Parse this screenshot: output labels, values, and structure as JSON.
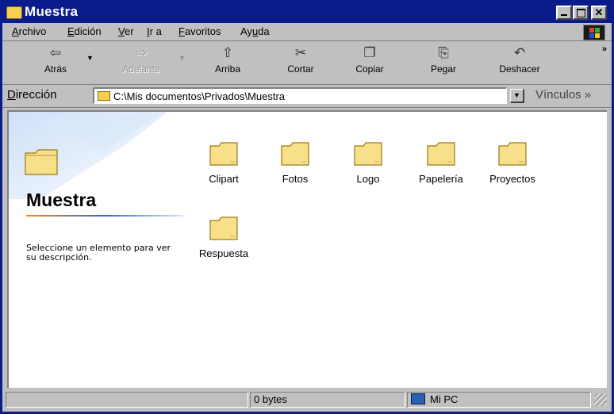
{
  "window": {
    "title": "Muestra",
    "controls": [
      "minimize-icon",
      "maximize-icon",
      "close-icon"
    ]
  },
  "menu": {
    "items": [
      {
        "label": "Archivo",
        "hotkey": "A"
      },
      {
        "label": "Edición",
        "hotkey": "E"
      },
      {
        "label": "Ver",
        "hotkey": "V"
      },
      {
        "label": "Ir a",
        "hotkey": "I"
      },
      {
        "label": "Favoritos",
        "hotkey": "F"
      },
      {
        "label": "Ayuda",
        "hotkey": "u"
      }
    ]
  },
  "toolbar": {
    "back": {
      "label": "Atrás",
      "icon": "back-arrow-icon"
    },
    "forward": {
      "label": "Adelante",
      "icon": "forward-arrow-icon",
      "disabled": true
    },
    "up": {
      "label": "Arriba",
      "icon": "up-folder-icon"
    },
    "cut": {
      "label": "Cortar",
      "icon": "scissors-icon"
    },
    "copy": {
      "label": "Copiar",
      "icon": "copy-icon"
    },
    "paste": {
      "label": "Pegar",
      "icon": "paste-icon"
    },
    "undo": {
      "label": "Deshacer",
      "icon": "undo-icon"
    },
    "more": "»"
  },
  "address": {
    "label": "Dirección",
    "hotkey": "D",
    "value": "C:\\Mis documentos\\Privados\\Muestra",
    "links": "Vínculos »"
  },
  "left_panel": {
    "title": "Muestra",
    "description": "Seleccione un elemento para ver su descripción."
  },
  "files": [
    {
      "name": "Clipart",
      "icon": "folder-icon"
    },
    {
      "name": "Fotos",
      "icon": "folder-icon"
    },
    {
      "name": "Logo",
      "icon": "folder-icon"
    },
    {
      "name": "Papelería",
      "icon": "folder-icon"
    },
    {
      "name": "Proyectos",
      "icon": "folder-icon"
    },
    {
      "name": "Respuesta",
      "icon": "folder-icon"
    }
  ],
  "status": {
    "size": "0 bytes",
    "location": "Mi PC"
  },
  "colors": {
    "titlebar": "#0a1b8c",
    "chrome": "#c0c0c0",
    "folder": "#f4d04e"
  }
}
